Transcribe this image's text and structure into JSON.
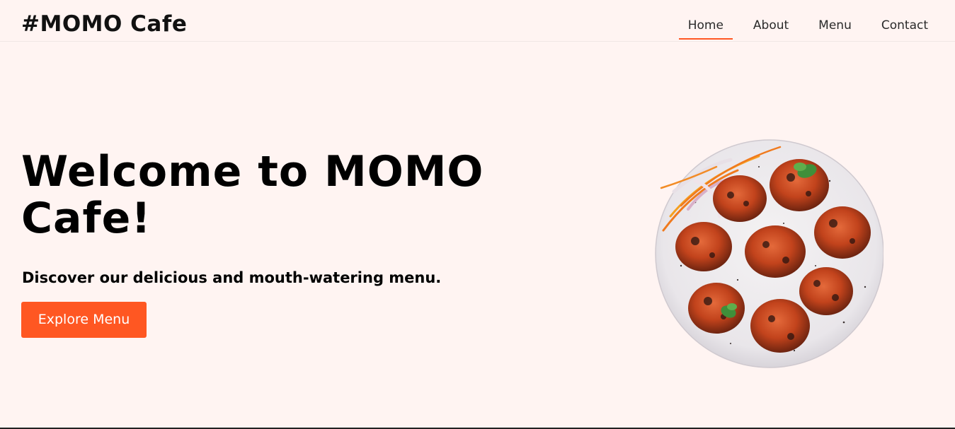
{
  "header": {
    "brand": "#MOMO Cafe",
    "nav": [
      {
        "label": "Home",
        "active": true
      },
      {
        "label": "About",
        "active": false
      },
      {
        "label": "Menu",
        "active": false
      },
      {
        "label": "Contact",
        "active": false
      }
    ]
  },
  "hero": {
    "title": "Welcome to MOMO Cafe!",
    "subtitle": "Discover our delicious and mouth-watering menu.",
    "cta_label": "Explore Menu",
    "image_icon": "momo-plate-image"
  },
  "colors": {
    "background": "#fff4f2",
    "accent": "#ff5722",
    "text": "#000000"
  }
}
